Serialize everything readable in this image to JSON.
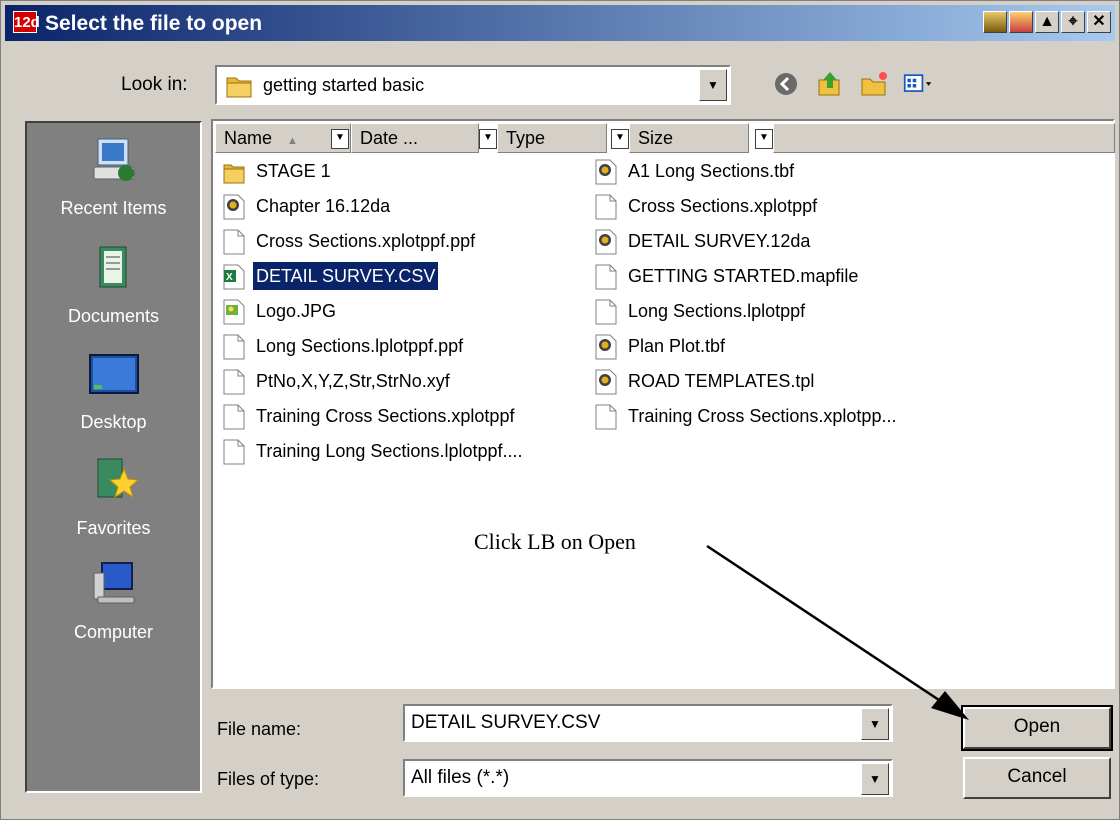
{
  "window": {
    "title": "Select the file to open",
    "app_icon_text": "12d",
    "title_buttons": [
      "help-icon",
      "heart-icon",
      "maximize-icon",
      "pin-icon",
      "close-icon"
    ]
  },
  "lookin": {
    "label": "Look in:",
    "value": "getting started basic"
  },
  "nav": [
    "back-icon",
    "up-folder-icon",
    "new-folder-icon",
    "view-menu-icon"
  ],
  "places": [
    {
      "label": "Recent Items",
      "icon": "recent-items-icon"
    },
    {
      "label": "Documents",
      "icon": "documents-icon"
    },
    {
      "label": "Desktop",
      "icon": "desktop-icon"
    },
    {
      "label": "Favorites",
      "icon": "favorites-icon"
    },
    {
      "label": "Computer",
      "icon": "computer-icon"
    }
  ],
  "columns": [
    "Name",
    "Date ...",
    "Type",
    "Size"
  ],
  "files_left": [
    {
      "name": "STAGE 1",
      "icon": "folder"
    },
    {
      "name": "Chapter 16.12da",
      "icon": "app"
    },
    {
      "name": "Cross Sections.xplotppf.ppf",
      "icon": "doc"
    },
    {
      "name": "DETAIL SURVEY.CSV",
      "icon": "excel",
      "selected": true
    },
    {
      "name": "Logo.JPG",
      "icon": "image"
    },
    {
      "name": "Long Sections.lplotppf.ppf",
      "icon": "doc"
    },
    {
      "name": "PtNo,X,Y,Z,Str,StrNo.xyf",
      "icon": "doc"
    },
    {
      "name": "Training Cross Sections.xplotppf",
      "icon": "doc"
    },
    {
      "name": "Training Long Sections.lplotppf....",
      "icon": "doc"
    }
  ],
  "files_right": [
    {
      "name": "A1 Long Sections.tbf",
      "icon": "app"
    },
    {
      "name": "Cross Sections.xplotppf",
      "icon": "doc"
    },
    {
      "name": "DETAIL SURVEY.12da",
      "icon": "app"
    },
    {
      "name": "GETTING STARTED.mapfile",
      "icon": "doc"
    },
    {
      "name": "Long Sections.lplotppf",
      "icon": "doc"
    },
    {
      "name": "Plan Plot.tbf",
      "icon": "app"
    },
    {
      "name": "ROAD TEMPLATES.tpl",
      "icon": "app"
    },
    {
      "name": "Training Cross Sections.xplotpp...",
      "icon": "doc"
    }
  ],
  "filename": {
    "label": "File name:",
    "value": "DETAIL SURVEY.CSV"
  },
  "filetype": {
    "label": "Files of type:",
    "value": "All files (*.*)"
  },
  "buttons": {
    "open": "Open",
    "cancel": "Cancel"
  },
  "annotation": "Click LB on Open"
}
